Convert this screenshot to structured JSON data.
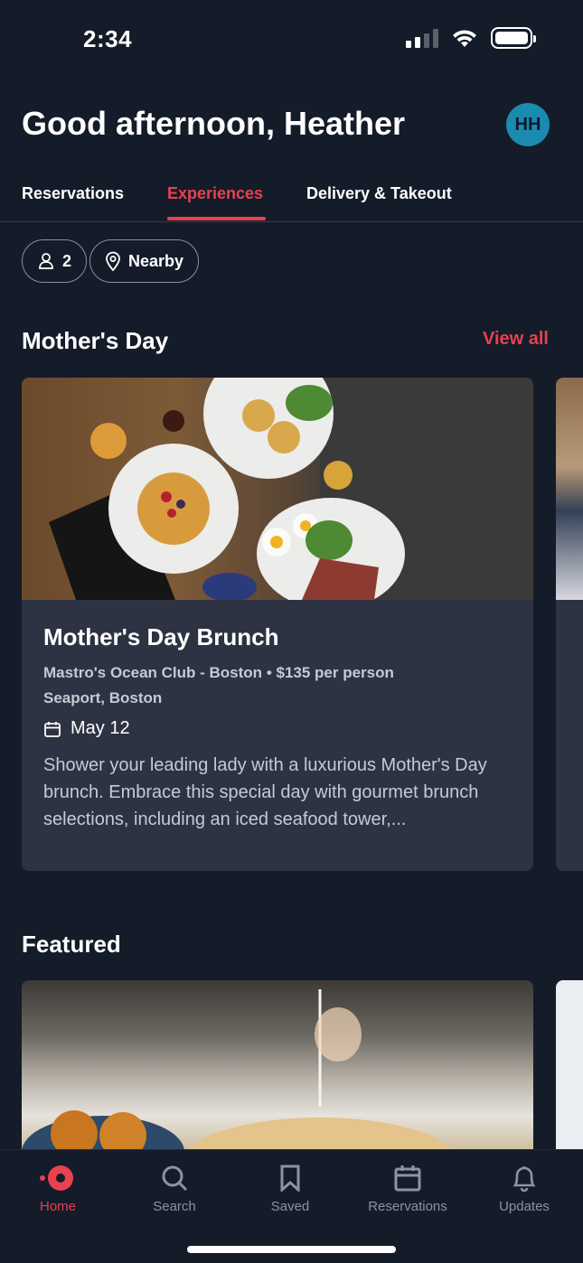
{
  "status_bar": {
    "time": "2:34"
  },
  "header": {
    "greeting": "Good afternoon, Heather",
    "avatar_initials": "HH"
  },
  "tabs": [
    {
      "label": "Reservations",
      "active": false
    },
    {
      "label": "Experiences",
      "active": true
    },
    {
      "label": "Delivery & Takeout",
      "active": false
    }
  ],
  "filters": {
    "party_size": "2",
    "location": "Nearby"
  },
  "mothers_day": {
    "title": "Mother's Day",
    "view_all": "View all",
    "card": {
      "title": "Mother's Day Brunch",
      "restaurant": "Mastro's Ocean Club - Boston",
      "separator": "•",
      "price": "$135 per person",
      "neighborhood": "Seaport, Boston",
      "date": "May 12",
      "description": "Shower your leading lady with a luxurious Mother's Day brunch. Embrace this special day with gourmet brunch selections, including an iced seafood tower,..."
    }
  },
  "featured": {
    "title": "Featured"
  },
  "bottom_nav": [
    {
      "label": "Home",
      "icon": "home-dot-icon",
      "active": true
    },
    {
      "label": "Search",
      "icon": "search-icon",
      "active": false
    },
    {
      "label": "Saved",
      "icon": "bookmark-icon",
      "active": false
    },
    {
      "label": "Reservations",
      "icon": "calendar-icon",
      "active": false
    },
    {
      "label": "Updates",
      "icon": "bell-icon",
      "active": false
    }
  ],
  "colors": {
    "background": "#141b29",
    "card": "#2d3342",
    "accent": "#e8414f",
    "avatar": "#1b8bb0"
  }
}
